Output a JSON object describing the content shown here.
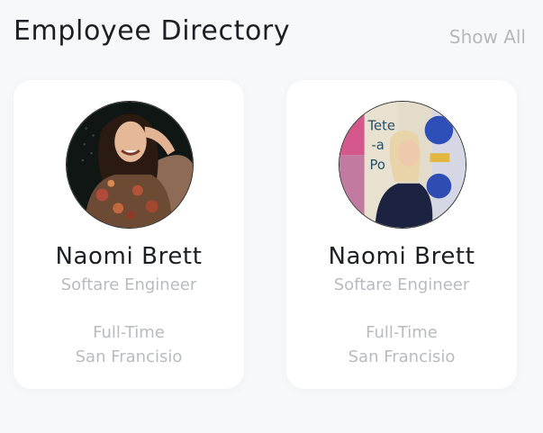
{
  "header": {
    "title": "Employee Directory",
    "show_all_label": "Show All"
  },
  "employees": [
    {
      "name": "Naomi Brett",
      "role": "Softare Engineer",
      "employment_type": "Full-Time",
      "location": "San Francisio",
      "avatar_icon": "photo-avatar-dark-background"
    },
    {
      "name": "Naomi Brett",
      "role": "Softare Engineer",
      "employment_type": "Full-Time",
      "location": "San Francisio",
      "avatar_icon": "photo-avatar-poster-wall"
    }
  ],
  "colors": {
    "background": "#f7f8fa",
    "card": "#ffffff",
    "text_primary": "#1d1f24",
    "text_secondary": "#b9bbbf"
  }
}
